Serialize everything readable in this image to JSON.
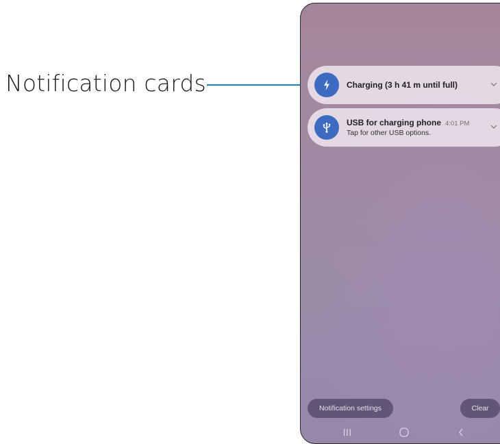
{
  "callout": {
    "label": "Notification cards",
    "line_color": "#1f7fc4"
  },
  "notifications": [
    {
      "icon": "lightning-bolt-icon",
      "title": "Charging (3 h 41 m until full)",
      "time": "",
      "subtitle": ""
    },
    {
      "icon": "usb-icon",
      "title": "USB for charging phone",
      "time": "4:01 PM",
      "subtitle": "Tap for other USB options."
    }
  ],
  "actions": {
    "settings_label": "Notification settings",
    "clear_label": "Clear"
  },
  "navbar": {
    "recents_icon": "recents-icon",
    "home_icon": "home-icon",
    "back_icon": "back-icon"
  },
  "colors": {
    "icon_bg": "#3e6bc2",
    "card_bg": "#e8dee8",
    "pill_bg": "#554b69"
  }
}
